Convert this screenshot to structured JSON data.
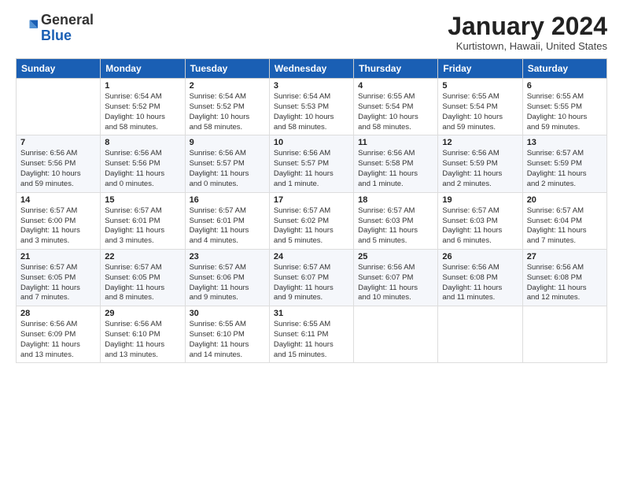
{
  "header": {
    "logo_general": "General",
    "logo_blue": "Blue",
    "month_title": "January 2024",
    "location": "Kurtistown, Hawaii, United States"
  },
  "weekdays": [
    "Sunday",
    "Monday",
    "Tuesday",
    "Wednesday",
    "Thursday",
    "Friday",
    "Saturday"
  ],
  "weeks": [
    [
      {
        "day": "",
        "info": ""
      },
      {
        "day": "1",
        "info": "Sunrise: 6:54 AM\nSunset: 5:52 PM\nDaylight: 10 hours\nand 58 minutes."
      },
      {
        "day": "2",
        "info": "Sunrise: 6:54 AM\nSunset: 5:52 PM\nDaylight: 10 hours\nand 58 minutes."
      },
      {
        "day": "3",
        "info": "Sunrise: 6:54 AM\nSunset: 5:53 PM\nDaylight: 10 hours\nand 58 minutes."
      },
      {
        "day": "4",
        "info": "Sunrise: 6:55 AM\nSunset: 5:54 PM\nDaylight: 10 hours\nand 58 minutes."
      },
      {
        "day": "5",
        "info": "Sunrise: 6:55 AM\nSunset: 5:54 PM\nDaylight: 10 hours\nand 59 minutes."
      },
      {
        "day": "6",
        "info": "Sunrise: 6:55 AM\nSunset: 5:55 PM\nDaylight: 10 hours\nand 59 minutes."
      }
    ],
    [
      {
        "day": "7",
        "info": "Sunrise: 6:56 AM\nSunset: 5:56 PM\nDaylight: 10 hours\nand 59 minutes."
      },
      {
        "day": "8",
        "info": "Sunrise: 6:56 AM\nSunset: 5:56 PM\nDaylight: 11 hours\nand 0 minutes."
      },
      {
        "day": "9",
        "info": "Sunrise: 6:56 AM\nSunset: 5:57 PM\nDaylight: 11 hours\nand 0 minutes."
      },
      {
        "day": "10",
        "info": "Sunrise: 6:56 AM\nSunset: 5:57 PM\nDaylight: 11 hours\nand 1 minute."
      },
      {
        "day": "11",
        "info": "Sunrise: 6:56 AM\nSunset: 5:58 PM\nDaylight: 11 hours\nand 1 minute."
      },
      {
        "day": "12",
        "info": "Sunrise: 6:56 AM\nSunset: 5:59 PM\nDaylight: 11 hours\nand 2 minutes."
      },
      {
        "day": "13",
        "info": "Sunrise: 6:57 AM\nSunset: 5:59 PM\nDaylight: 11 hours\nand 2 minutes."
      }
    ],
    [
      {
        "day": "14",
        "info": "Sunrise: 6:57 AM\nSunset: 6:00 PM\nDaylight: 11 hours\nand 3 minutes."
      },
      {
        "day": "15",
        "info": "Sunrise: 6:57 AM\nSunset: 6:01 PM\nDaylight: 11 hours\nand 3 minutes."
      },
      {
        "day": "16",
        "info": "Sunrise: 6:57 AM\nSunset: 6:01 PM\nDaylight: 11 hours\nand 4 minutes."
      },
      {
        "day": "17",
        "info": "Sunrise: 6:57 AM\nSunset: 6:02 PM\nDaylight: 11 hours\nand 5 minutes."
      },
      {
        "day": "18",
        "info": "Sunrise: 6:57 AM\nSunset: 6:03 PM\nDaylight: 11 hours\nand 5 minutes."
      },
      {
        "day": "19",
        "info": "Sunrise: 6:57 AM\nSunset: 6:03 PM\nDaylight: 11 hours\nand 6 minutes."
      },
      {
        "day": "20",
        "info": "Sunrise: 6:57 AM\nSunset: 6:04 PM\nDaylight: 11 hours\nand 7 minutes."
      }
    ],
    [
      {
        "day": "21",
        "info": "Sunrise: 6:57 AM\nSunset: 6:05 PM\nDaylight: 11 hours\nand 7 minutes."
      },
      {
        "day": "22",
        "info": "Sunrise: 6:57 AM\nSunset: 6:05 PM\nDaylight: 11 hours\nand 8 minutes."
      },
      {
        "day": "23",
        "info": "Sunrise: 6:57 AM\nSunset: 6:06 PM\nDaylight: 11 hours\nand 9 minutes."
      },
      {
        "day": "24",
        "info": "Sunrise: 6:57 AM\nSunset: 6:07 PM\nDaylight: 11 hours\nand 9 minutes."
      },
      {
        "day": "25",
        "info": "Sunrise: 6:56 AM\nSunset: 6:07 PM\nDaylight: 11 hours\nand 10 minutes."
      },
      {
        "day": "26",
        "info": "Sunrise: 6:56 AM\nSunset: 6:08 PM\nDaylight: 11 hours\nand 11 minutes."
      },
      {
        "day": "27",
        "info": "Sunrise: 6:56 AM\nSunset: 6:08 PM\nDaylight: 11 hours\nand 12 minutes."
      }
    ],
    [
      {
        "day": "28",
        "info": "Sunrise: 6:56 AM\nSunset: 6:09 PM\nDaylight: 11 hours\nand 13 minutes."
      },
      {
        "day": "29",
        "info": "Sunrise: 6:56 AM\nSunset: 6:10 PM\nDaylight: 11 hours\nand 13 minutes."
      },
      {
        "day": "30",
        "info": "Sunrise: 6:55 AM\nSunset: 6:10 PM\nDaylight: 11 hours\nand 14 minutes."
      },
      {
        "day": "31",
        "info": "Sunrise: 6:55 AM\nSunset: 6:11 PM\nDaylight: 11 hours\nand 15 minutes."
      },
      {
        "day": "",
        "info": ""
      },
      {
        "day": "",
        "info": ""
      },
      {
        "day": "",
        "info": ""
      }
    ]
  ]
}
